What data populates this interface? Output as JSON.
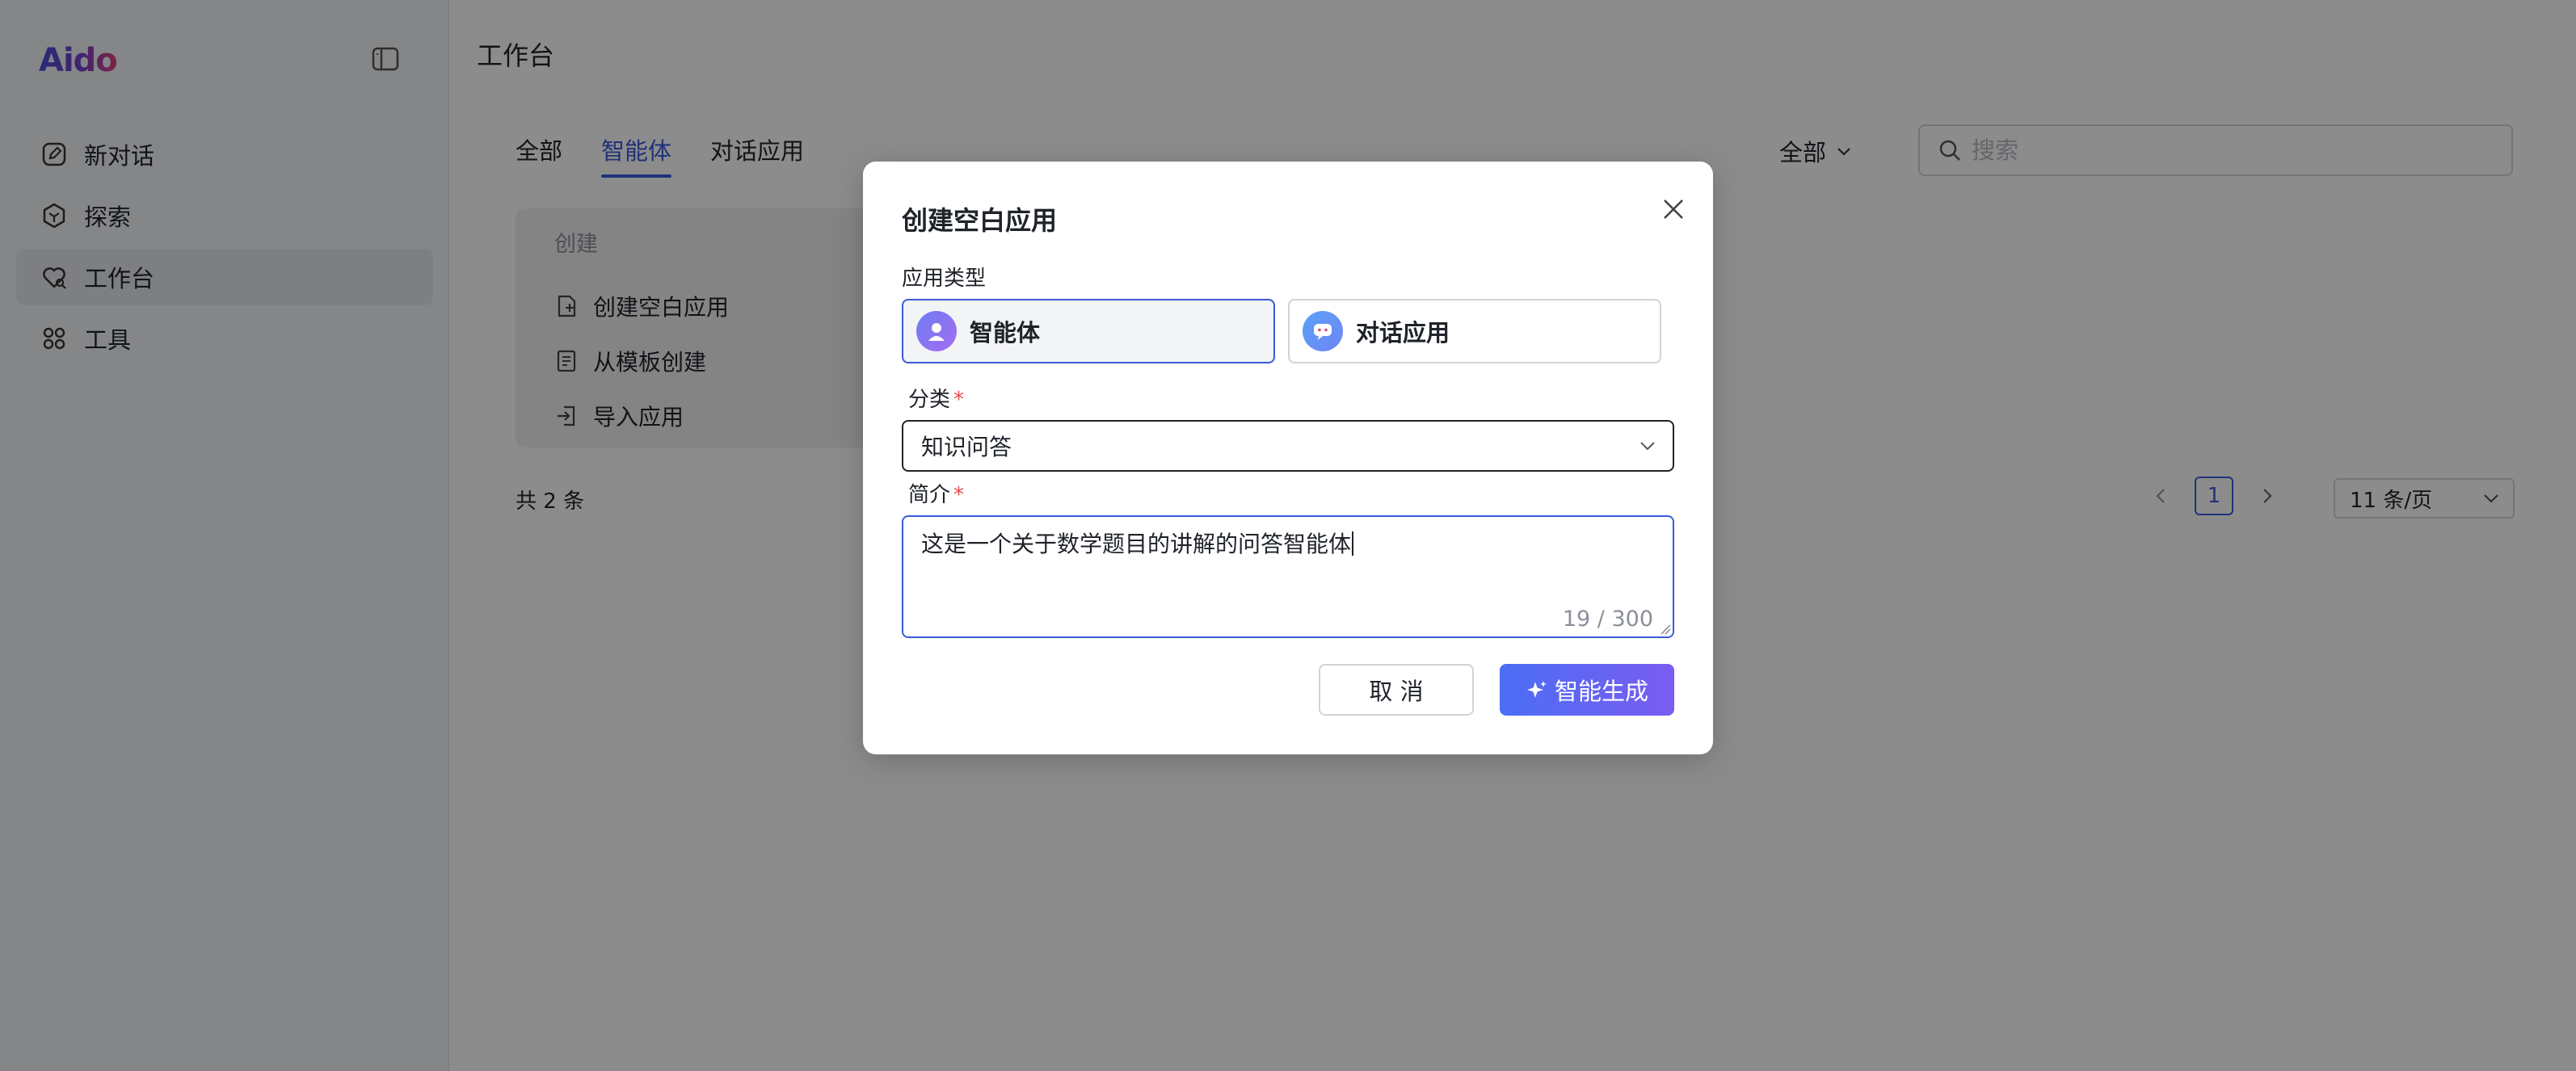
{
  "app": {
    "logo": "Aido"
  },
  "sidebar": {
    "items": [
      {
        "label": "新对话",
        "icon": "edit-icon"
      },
      {
        "label": "探索",
        "icon": "explore-icon"
      },
      {
        "label": "工作台",
        "icon": "workbench-icon",
        "active": true
      },
      {
        "label": "工具",
        "icon": "tools-icon"
      }
    ]
  },
  "main": {
    "title": "工作台",
    "tabs": [
      "全部",
      "智能体",
      "对话应用"
    ],
    "active_tab": "智能体",
    "filter": "全部",
    "search_placeholder": "搜索",
    "create": {
      "heading": "创建",
      "items": [
        "创建空白应用",
        "从模板创建",
        "导入应用"
      ]
    },
    "total": "共 2 条",
    "pager": {
      "current": "1",
      "page_size": "11 条/页"
    }
  },
  "modal": {
    "title": "创建空白应用",
    "type_label": "应用类型",
    "types": [
      {
        "label": "智能体",
        "selected": true
      },
      {
        "label": "对话应用",
        "selected": false
      }
    ],
    "category_label": "分类",
    "category_value": "知识问答",
    "intro_label": "简介",
    "intro_value": "这是一个关于数学题目的讲解的问答智能体",
    "counter": "19 / 300",
    "cancel": "取 消",
    "generate": "智能生成"
  },
  "colors": {
    "accent": "#3b5bdb",
    "required": "#e5484d"
  }
}
